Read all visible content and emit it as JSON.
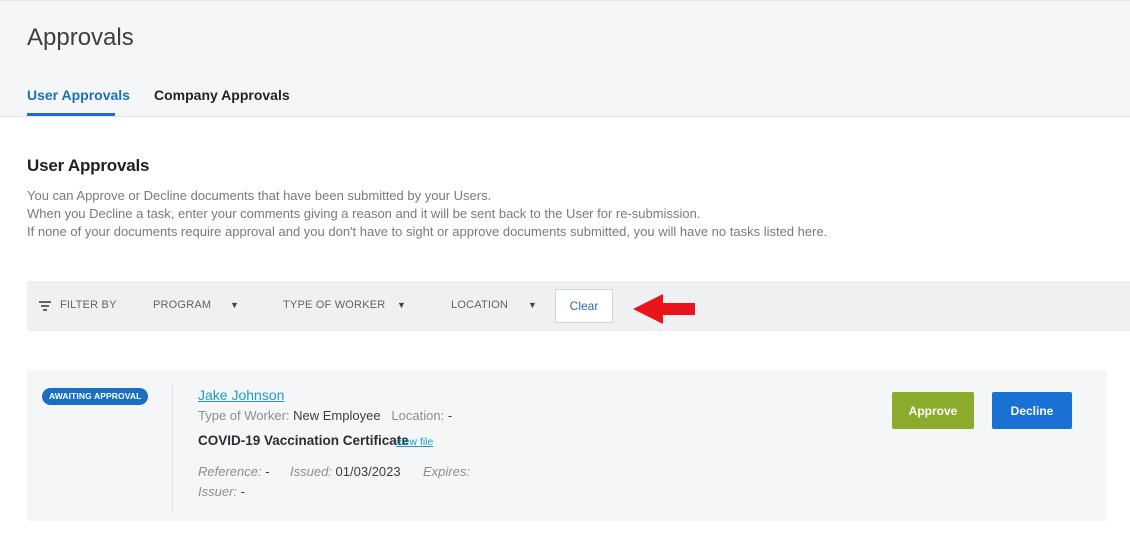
{
  "page": {
    "title": "Approvals",
    "tabs": [
      {
        "label": "User Approvals",
        "active": true
      },
      {
        "label": "Company Approvals",
        "active": false
      }
    ]
  },
  "section": {
    "title": "User Approvals",
    "description": [
      "You can Approve or Decline documents that have been submitted by your Users.",
      "When you Decline a task, enter your comments giving a reason and it will be sent back to the User for re-submission.",
      "If none of your documents require approval and you don't have to sight or approve documents submitted, you will have no tasks listed here."
    ]
  },
  "filters": {
    "filter_by": "FILTER BY",
    "program": "PROGRAM",
    "type_of_worker": "TYPE OF WORKER",
    "location": "LOCATION",
    "clear": "Clear"
  },
  "annotation": {
    "arrow_color": "#e8151b"
  },
  "approval": {
    "status": "AWAITING APPROVAL",
    "name": "Jake Johnson",
    "type_of_worker_label": "Type of Worker:",
    "type_of_worker": "New Employee",
    "location_label": "Location:",
    "location": "-",
    "document": "COVID-19 Vaccination Certificate",
    "view_file": "view file",
    "reference_label": "Reference:",
    "reference": "-",
    "issued_label": "Issued:",
    "issued": "01/03/2023",
    "expires_label": "Expires:",
    "expires": "",
    "issuer_label": "Issuer:",
    "issuer": "-",
    "approve": "Approve",
    "decline": "Decline"
  },
  "colors": {
    "accent": "#1b6fc2",
    "approve": "#8aab2c",
    "decline": "#1971d4",
    "link": "#1a9fc0"
  }
}
